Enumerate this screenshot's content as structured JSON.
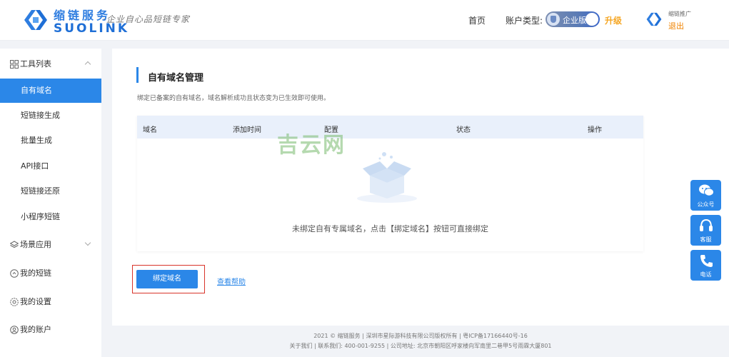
{
  "header": {
    "brand_cn": "缩链服务",
    "brand_en": "SUOLINK",
    "slogan": "·企业自心品短链专家",
    "nav_home": "首页",
    "account_type_label": "账户类型:",
    "plan_name": "企业版",
    "upgrade": "升级",
    "user_name": "缩链推广",
    "logout": "退出"
  },
  "sidebar": {
    "items": [
      {
        "label": "工具列表",
        "icon": "grid-icon",
        "type": "group",
        "expanded": true
      },
      {
        "label": "自有域名",
        "active": true
      },
      {
        "label": "短链接生成"
      },
      {
        "label": "批量生成"
      },
      {
        "label": "API接口"
      },
      {
        "label": "短链接还原"
      },
      {
        "label": "小程序短链"
      },
      {
        "label": "场景应用",
        "icon": "layers-icon",
        "type": "group",
        "expanded": false
      },
      {
        "label": "我的短链",
        "icon": "link-circle-icon",
        "type": "group"
      },
      {
        "label": "我的设置",
        "icon": "gear-icon",
        "type": "group"
      },
      {
        "label": "我的账户",
        "icon": "user-circle-icon",
        "type": "group"
      }
    ]
  },
  "main": {
    "title": "自有域名管理",
    "description": "绑定已备案的自有域名，域名解析成功且状态变为已生效即可使用。",
    "table": {
      "columns": [
        "域名",
        "添加时间",
        "配置",
        "状态",
        "操作"
      ],
      "empty_text": "未绑定自有专属域名，点击【绑定域名】按钮可直接绑定"
    },
    "bind_button": "绑定域名",
    "help_link": "查看帮助"
  },
  "watermark": "吉云网",
  "float": {
    "wechat": "公众号",
    "service": "客服",
    "phone": "电话"
  },
  "footer": {
    "line1": "2021 © 缩链服务 | 深圳市星际游科技有限公司版权所有 | 粤ICP备17166440号-16",
    "line2": "关于我们 | 联系我们: 400-001-9255 | 公司地址: 北京市朝阳区呼家楼向军南里二巷甲5号雨霖大厦801"
  },
  "colors": {
    "accent": "#2b87e8",
    "upgrade": "#f5a623",
    "logout": "#f08300",
    "highlight_border": "#d9342b"
  }
}
